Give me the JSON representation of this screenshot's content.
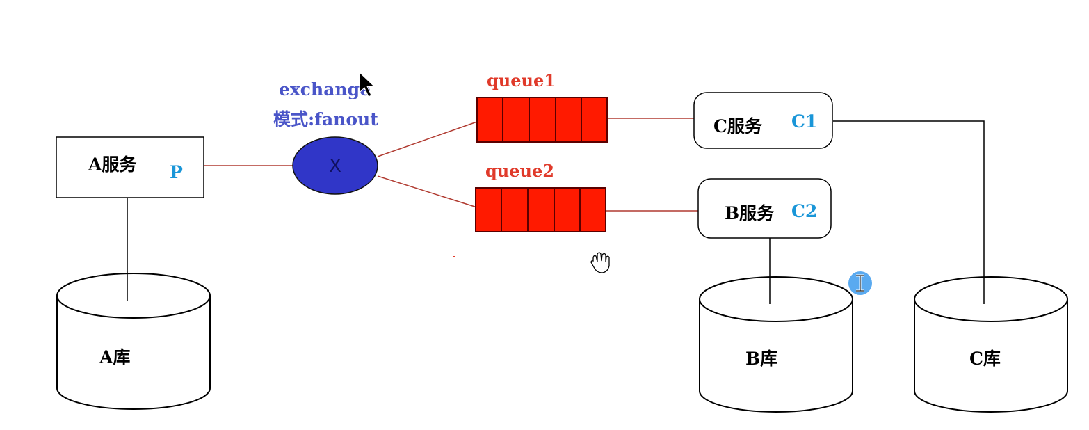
{
  "producer": {
    "label": "A服务",
    "tag": "P"
  },
  "exchange": {
    "title": "exchange",
    "mode": "模式:fanout",
    "symbol": "X"
  },
  "queues": [
    {
      "label": "queue1"
    },
    {
      "label": "queue2"
    }
  ],
  "consumers": [
    {
      "label": "C服务",
      "tag": "C1"
    },
    {
      "label": "B服务",
      "tag": "C2"
    }
  ],
  "databases": [
    {
      "label": "A库"
    },
    {
      "label": "B库"
    },
    {
      "label": "C库"
    }
  ],
  "colors": {
    "queue_fill": "#ff1a00",
    "exchange_fill": "#3036c8",
    "exchange_text": "#4a55c8",
    "queue_text": "#e03a2a",
    "tag_text": "#1a96d8",
    "link_line": "#b03a30"
  }
}
